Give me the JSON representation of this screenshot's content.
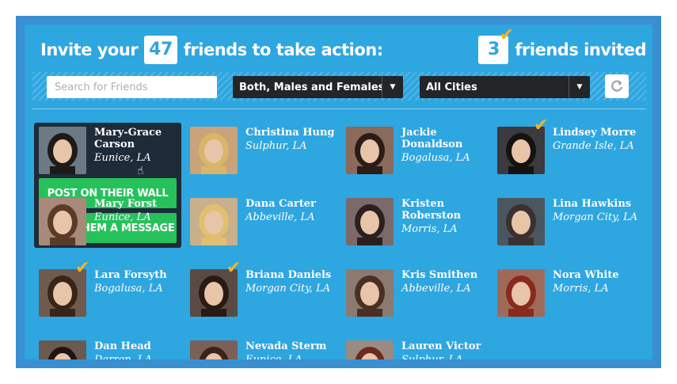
{
  "header": {
    "invite_prefix": "Invite your",
    "friend_count": "47",
    "invite_suffix": "friends to take action:",
    "invited_count": "3",
    "invited_label": "friends invited"
  },
  "filters": {
    "search_placeholder": "Search for Friends",
    "gender_value": "Both, Males and Females",
    "city_value": "All Cities"
  },
  "actions": {
    "post_wall": "POST ON THEIR WALL",
    "send_message": "SEND THEM A MESSAGE"
  },
  "colors": {
    "panel": "#2ea6e0",
    "frame": "#3a8fd0",
    "action_green": "#27c15b",
    "check_gold": "#f5b41f",
    "selected_bg": "#1e2b38"
  },
  "friends": [
    {
      "name": "Mary-Grace Carson",
      "location": "Eunice, LA",
      "invited": false,
      "selected": true
    },
    {
      "name": "Christina Hung",
      "location": "Sulphur, LA",
      "invited": false
    },
    {
      "name": "Jackie Donaldson",
      "location": "Bogalusa, LA",
      "invited": false
    },
    {
      "name": "Lindsey Morre",
      "location": "Grande Isle, LA",
      "invited": true
    },
    {
      "name": "Mary Forst",
      "location": "Eunice, LA",
      "invited": false
    },
    {
      "name": "Dana Carter",
      "location": "Abbeville, LA",
      "invited": false
    },
    {
      "name": "Kristen Roberston",
      "location": "Morris, LA",
      "invited": false
    },
    {
      "name": "Lina Hawkins",
      "location": "Morgan City, LA",
      "invited": false
    },
    {
      "name": "Lara Forsyth",
      "location": "Bogalusa, LA",
      "invited": true
    },
    {
      "name": "Briana Daniels",
      "location": "Morgan City, LA",
      "invited": true
    },
    {
      "name": "Kris Smithen",
      "location": "Abbeville, LA",
      "invited": false
    },
    {
      "name": "Nora White",
      "location": "Morris, LA",
      "invited": false
    },
    {
      "name": "Dan Head",
      "location": "Darren, LA",
      "invited": false
    },
    {
      "name": "Nevada Sterm",
      "location": "Eunice, LA",
      "invited": false
    },
    {
      "name": "Lauren Victor",
      "location": "Sulphur, LA",
      "invited": false
    }
  ]
}
